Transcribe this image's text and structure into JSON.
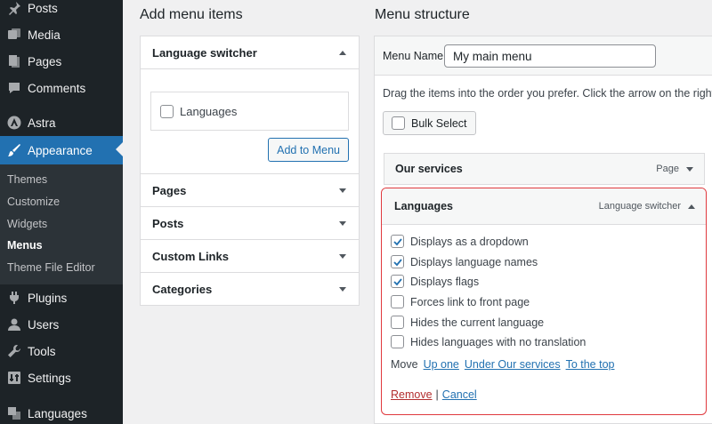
{
  "sidebar": {
    "items": [
      {
        "label": "Posts",
        "icon": "pin-icon"
      },
      {
        "label": "Media",
        "icon": "media-icon"
      },
      {
        "label": "Pages",
        "icon": "pages-icon"
      },
      {
        "label": "Comments",
        "icon": "comments-icon"
      },
      {
        "label": "Astra",
        "icon": "astra-icon"
      },
      {
        "label": "Appearance",
        "icon": "paintbrush-icon"
      },
      {
        "label": "Plugins",
        "icon": "plugins-icon"
      },
      {
        "label": "Users",
        "icon": "users-icon"
      },
      {
        "label": "Tools",
        "icon": "tools-icon"
      },
      {
        "label": "Settings",
        "icon": "settings-icon"
      },
      {
        "label": "Languages",
        "icon": "translation-icon"
      }
    ],
    "submenu": [
      "Themes",
      "Customize",
      "Widgets",
      "Menus",
      "Theme File Editor"
    ],
    "current_submenu": "Menus",
    "active_item": "Appearance",
    "colors": {
      "bg": "#1d2327",
      "active": "#2271b1",
      "submenu_bg": "#2c3338"
    }
  },
  "add_items": {
    "heading": "Add menu items",
    "open_panel": {
      "title": "Language switcher",
      "checkbox_label": "Languages",
      "button_label": "Add to Menu"
    },
    "panels": [
      "Pages",
      "Posts",
      "Custom Links",
      "Categories"
    ]
  },
  "structure": {
    "heading": "Menu structure",
    "menu_name_label": "Menu Name",
    "menu_name_value": "My main menu",
    "instructions": "Drag the items into the order you prefer. Click the arrow on the right of the item to reveal additional configuration options.",
    "bulk_select_label": "Bulk Select",
    "items": [
      {
        "title": "Our services",
        "type": "Page"
      }
    ],
    "expanded_item": {
      "title": "Languages",
      "type": "Language switcher",
      "options": [
        {
          "label": "Displays as a dropdown",
          "checked": true
        },
        {
          "label": "Displays language names",
          "checked": true
        },
        {
          "label": "Displays flags",
          "checked": true
        },
        {
          "label": "Forces link to front page",
          "checked": false
        },
        {
          "label": "Hides the current language",
          "checked": false
        },
        {
          "label": "Hides languages with no translation",
          "checked": false
        }
      ],
      "move_label": "Move",
      "move_links": [
        "Up one",
        "Under Our services",
        "To the top"
      ],
      "remove_label": "Remove",
      "separator": "|",
      "cancel_label": "Cancel",
      "highlight_color": "#e0393e"
    }
  }
}
